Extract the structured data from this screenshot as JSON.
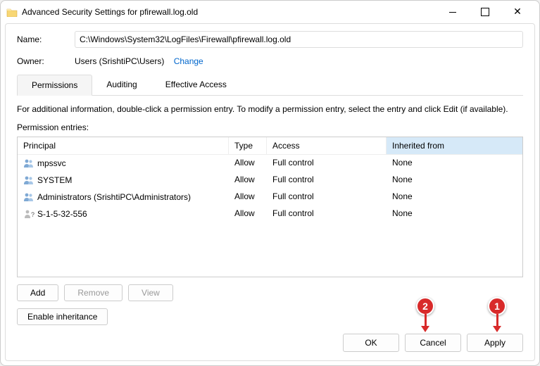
{
  "window": {
    "title": "Advanced Security Settings for pfirewall.log.old"
  },
  "name": {
    "label": "Name:",
    "value": "C:\\Windows\\System32\\LogFiles\\Firewall\\pfirewall.log.old"
  },
  "owner": {
    "label": "Owner:",
    "value": "Users (SrishtiPC\\Users)",
    "change": "Change"
  },
  "tabs": {
    "permissions": "Permissions",
    "auditing": "Auditing",
    "effective": "Effective Access"
  },
  "info": "For additional information, double-click a permission entry. To modify a permission entry, select the entry and click Edit (if available).",
  "entries_label": "Permission entries:",
  "headers": {
    "principal": "Principal",
    "type": "Type",
    "access": "Access",
    "inherited": "Inherited from"
  },
  "rows": [
    {
      "principal": "mpssvc",
      "type": "Allow",
      "access": "Full control",
      "inherited": "None",
      "icon": "group"
    },
    {
      "principal": "SYSTEM",
      "type": "Allow",
      "access": "Full control",
      "inherited": "None",
      "icon": "group"
    },
    {
      "principal": "Administrators (SrishtiPC\\Administrators)",
      "type": "Allow",
      "access": "Full control",
      "inherited": "None",
      "icon": "group"
    },
    {
      "principal": "S-1-5-32-556",
      "type": "Allow",
      "access": "Full control",
      "inherited": "None",
      "icon": "unknown"
    }
  ],
  "buttons": {
    "add": "Add",
    "remove": "Remove",
    "view": "View",
    "enable": "Enable inheritance"
  },
  "footer": {
    "ok": "OK",
    "cancel": "Cancel",
    "apply": "Apply"
  },
  "callouts": {
    "one": "1",
    "two": "2"
  }
}
